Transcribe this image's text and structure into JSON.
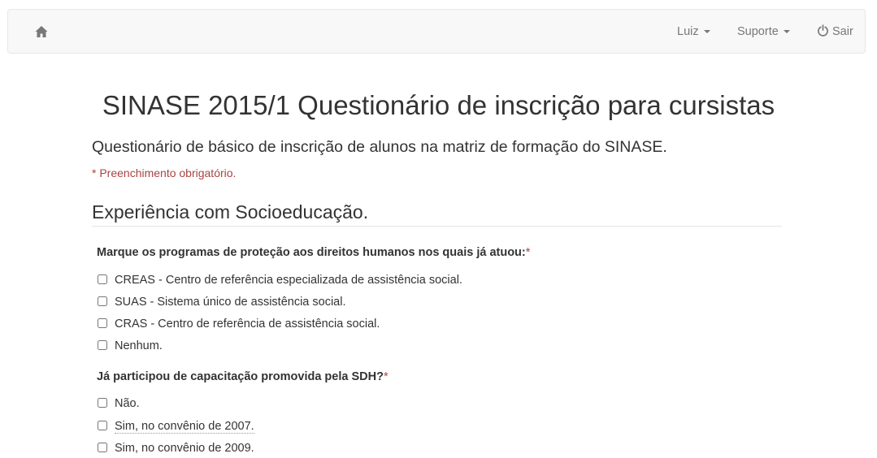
{
  "navbar": {
    "home_icon": "home-icon",
    "user_label": "Luiz",
    "support_label": "Suporte",
    "logout_label": "Sair",
    "logout_icon": "power-icon"
  },
  "page": {
    "title": "SINASE 2015/1 Questionário de inscrição para cursistas",
    "description": "Questionário de básico de inscrição de alunos na matriz de formação do SINASE.",
    "required_note": "* Preenchimento obrigatório."
  },
  "section": {
    "title": "Experiência com Socioeducação."
  },
  "questions": [
    {
      "label": "Marque os programas de proteção aos direitos humanos nos quais já atuou:",
      "required_mark": "*",
      "options": [
        "CREAS - Centro de referência especializada de assistência social.",
        "SUAS - Sistema único de assistência social.",
        "CRAS - Centro de referência de assistência social.",
        "Nenhum."
      ]
    },
    {
      "label": "Já participou de capacitação promovida pela SDH?",
      "required_mark": "*",
      "options": [
        "Não.",
        "Sim, no convênio de 2007.",
        "Sim, no convênio de 2009."
      ]
    }
  ],
  "colors": {
    "required": "#a94442",
    "text": "#333333",
    "nav_text": "#777777",
    "navbar_bg": "#f8f8f8"
  }
}
